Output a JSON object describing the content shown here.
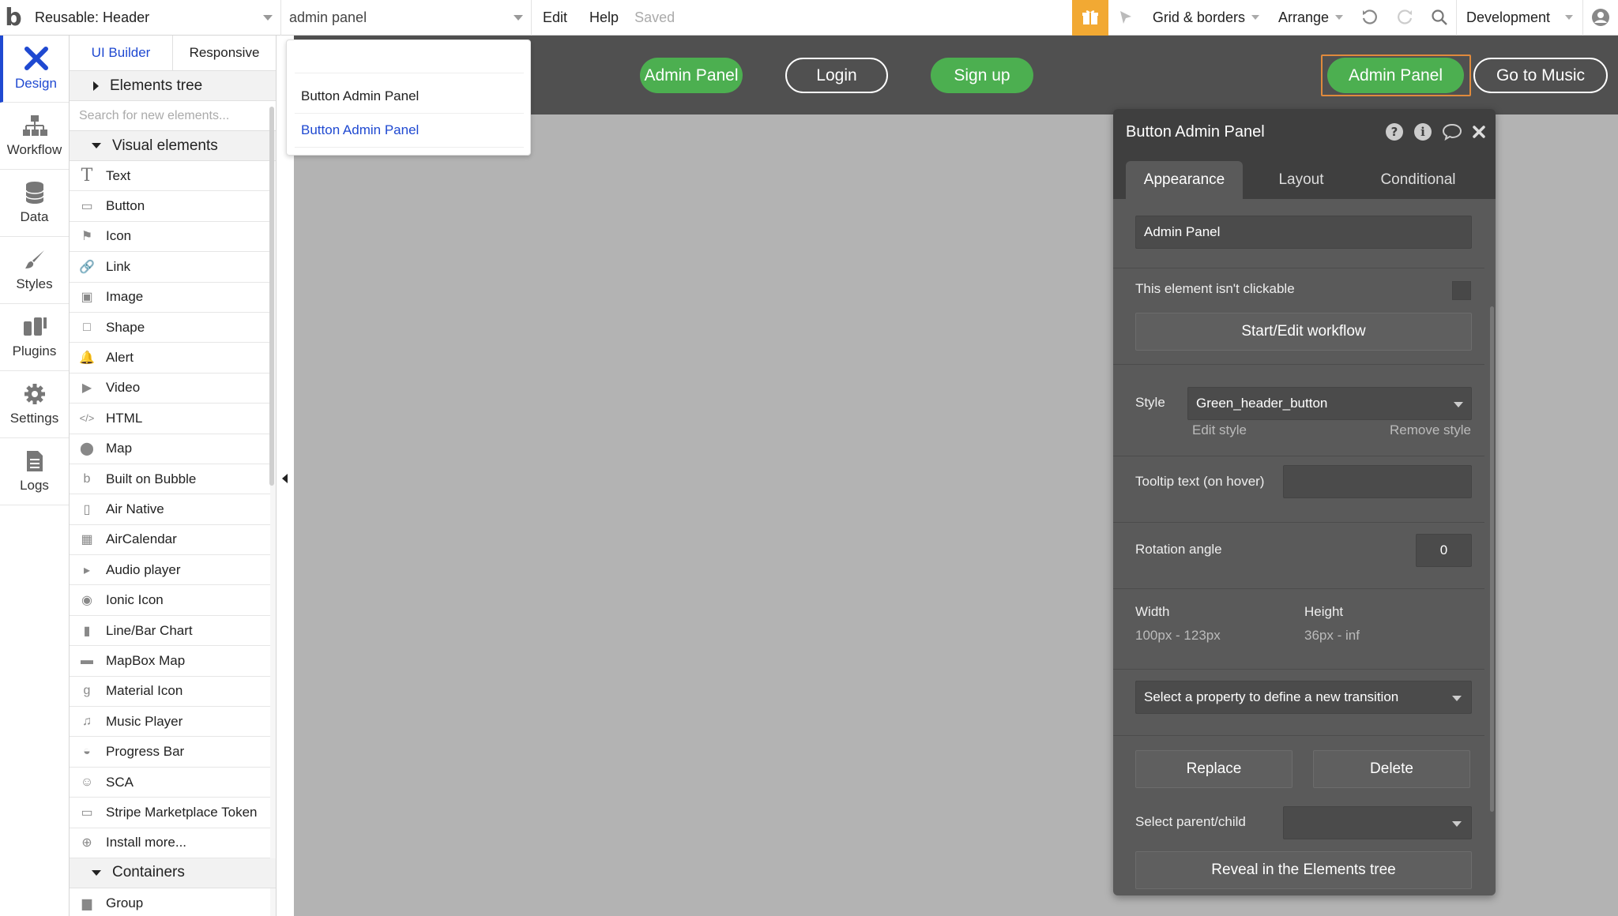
{
  "topbar": {
    "page_selector": "Reusable: Header",
    "element_search": "admin panel",
    "menu_edit": "Edit",
    "menu_help": "Help",
    "save_status": "Saved",
    "grid_menu": "Grid & borders",
    "arrange_menu": "Arrange",
    "version": "Development"
  },
  "rail": {
    "items": [
      {
        "label": "Design",
        "icon": "design-icon"
      },
      {
        "label": "Workflow",
        "icon": "workflow-icon"
      },
      {
        "label": "Data",
        "icon": "database-icon"
      },
      {
        "label": "Styles",
        "icon": "brush-icon"
      },
      {
        "label": "Plugins",
        "icon": "plug-icon"
      },
      {
        "label": "Settings",
        "icon": "gear-icon"
      },
      {
        "label": "Logs",
        "icon": "document-icon"
      }
    ]
  },
  "palette": {
    "tab_ui_builder": "UI Builder",
    "tab_responsive": "Responsive",
    "elements_tree": "Elements tree",
    "search_placeholder": "Search for new elements...",
    "visual_elements": "Visual elements",
    "containers": "Containers",
    "items": [
      {
        "label": "Text",
        "icon": "text-icon"
      },
      {
        "label": "Button",
        "icon": "button-icon"
      },
      {
        "label": "Icon",
        "icon": "flag-icon"
      },
      {
        "label": "Link",
        "icon": "link-icon"
      },
      {
        "label": "Image",
        "icon": "image-icon"
      },
      {
        "label": "Shape",
        "icon": "shape-icon"
      },
      {
        "label": "Alert",
        "icon": "bell-icon"
      },
      {
        "label": "Video",
        "icon": "video-icon"
      },
      {
        "label": "HTML",
        "icon": "code-icon"
      },
      {
        "label": "Map",
        "icon": "map-pin-icon"
      },
      {
        "label": "Built on Bubble",
        "icon": "bubble-logo-icon"
      },
      {
        "label": "Air Native",
        "icon": "phone-icon"
      },
      {
        "label": "AirCalendar",
        "icon": "calendar-icon"
      },
      {
        "label": "Audio player",
        "icon": "play-icon"
      },
      {
        "label": "Ionic Icon",
        "icon": "radio-icon"
      },
      {
        "label": "Line/Bar Chart",
        "icon": "bar-chart-icon"
      },
      {
        "label": "MapBox Map",
        "icon": "car-icon"
      },
      {
        "label": "Material Icon",
        "icon": "material-g-icon"
      },
      {
        "label": "Music Player",
        "icon": "music-note-icon"
      },
      {
        "label": "Progress Bar",
        "icon": "gauge-icon"
      },
      {
        "label": "SCA",
        "icon": "smiley-icon"
      },
      {
        "label": "Stripe Marketplace Token",
        "icon": "card-icon"
      },
      {
        "label": "Install more...",
        "icon": "plus-circle-icon"
      }
    ],
    "container_items": [
      {
        "label": "Group",
        "icon": "folder-icon"
      }
    ]
  },
  "dropdown": {
    "results": [
      "Button Admin Panel",
      "Button Admin Panel"
    ],
    "highlight_color": "#1f49d1"
  },
  "page_header": {
    "buttons": [
      {
        "label": "Admin Panel",
        "style": "green"
      },
      {
        "label": "Login",
        "style": "outline"
      },
      {
        "label": "Sign up",
        "style": "green"
      },
      {
        "label": "Admin Panel",
        "style": "green",
        "selected": true
      },
      {
        "label": "Go to Music",
        "style": "outline"
      }
    ],
    "bg_color": "#505050",
    "green": "#4caf50"
  },
  "editor": {
    "title": "Button Admin Panel",
    "tabs": [
      "Appearance",
      "Layout",
      "Conditional"
    ],
    "text_value": "Admin Panel",
    "not_clickable_label": "This element isn't clickable",
    "workflow_button": "Start/Edit workflow",
    "style_label": "Style",
    "style_value": "Green_header_button",
    "edit_style": "Edit style",
    "remove_style": "Remove style",
    "tooltip_label": "Tooltip text (on hover)",
    "rotation_label": "Rotation angle",
    "rotation_value": "0",
    "width_label": "Width",
    "width_value": "100px - 123px",
    "height_label": "Height",
    "height_value": "36px - inf",
    "transition_placeholder": "Select a property to define a new transition",
    "replace_button": "Replace",
    "delete_button": "Delete",
    "parent_child_label": "Select parent/child",
    "reveal_button": "Reveal in the Elements tree"
  }
}
